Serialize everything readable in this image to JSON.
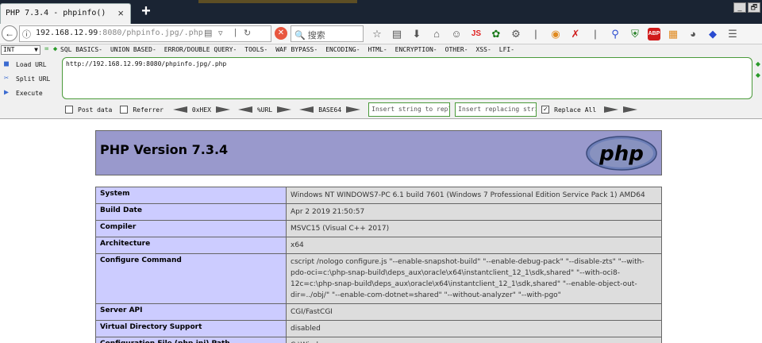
{
  "browser": {
    "tab_title": "PHP 7.3.4 - phpinfo()",
    "tab_close": "×",
    "new_tab": "+",
    "window_buttons": [
      "_",
      "🗗"
    ],
    "url_host": "192.168.12.99",
    "url_rest": ":8080/phpinfo.jpg/.php",
    "search_placeholder": "搜索"
  },
  "hackbar": {
    "select_value": "INT",
    "menu": [
      "SQL BASICS-",
      "UNION BASED-",
      "ERROR/DOUBLE QUERY-",
      "TOOLS-",
      "WAF BYPASS-",
      "ENCODING-",
      "HTML-",
      "ENCRYPTION-",
      "OTHER-",
      "XSS-",
      "LFI-"
    ],
    "load_url": "Load URL",
    "split_url": "Split URL",
    "execute": "Execute",
    "url_value": "http://192.168.12.99:8080/phpinfo.jpg/.php",
    "post_data": "Post data",
    "referrer": "Referrer",
    "hex": "0xHEX",
    "url_enc": "%URL",
    "base64": "BASE64",
    "insert_string": "Insert string to repl",
    "insert_replacing": "Insert replacing stri",
    "replace_all": "Replace All",
    "replace_all_checked": true
  },
  "php": {
    "version_title": "PHP Version 7.3.4",
    "logo_text": "php",
    "rows": [
      {
        "key": "System",
        "value": "Windows NT WINDOWS7-PC 6.1 build 7601 (Windows 7 Professional Edition Service Pack 1) AMD64"
      },
      {
        "key": "Build Date",
        "value": "Apr 2 2019 21:50:57"
      },
      {
        "key": "Compiler",
        "value": "MSVC15 (Visual C++ 2017)"
      },
      {
        "key": "Architecture",
        "value": "x64"
      },
      {
        "key": "Configure Command",
        "value": "cscript /nologo configure.js \"--enable-snapshot-build\" \"--enable-debug-pack\" \"--disable-zts\" \"--with-pdo-oci=c:\\php-snap-build\\deps_aux\\oracle\\x64\\instantclient_12_1\\sdk,shared\" \"--with-oci8-12c=c:\\php-snap-build\\deps_aux\\oracle\\x64\\instantclient_12_1\\sdk,shared\" \"--enable-object-out-dir=../obj/\" \"--enable-com-dotnet=shared\" \"--without-analyzer\" \"--with-pgo\""
      },
      {
        "key": "Server API",
        "value": "CGI/FastCGI"
      },
      {
        "key": "Virtual Directory Support",
        "value": "disabled"
      },
      {
        "key": "Configuration File (php.ini) Path",
        "value": "C:\\Windows"
      }
    ]
  }
}
